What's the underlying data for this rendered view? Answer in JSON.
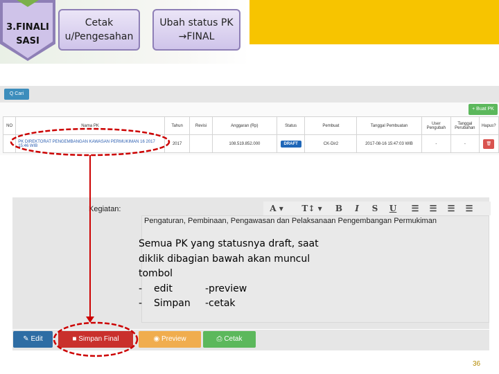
{
  "banner": {
    "step_label_line1": "3.FINALI",
    "step_label_line2": "SASI",
    "box1_line1": "Cetak",
    "box1_line2": "u/Pengesahan",
    "box2_line1": "Ubah status PK",
    "box2_line2": "→FINAL"
  },
  "search": {
    "cari_label": "Q Cari"
  },
  "create": {
    "buat_label": "+ Buat PK"
  },
  "table": {
    "headers": [
      "NO",
      "Nama PK",
      "Tahun",
      "Revisi",
      "Anggaran (Rp)",
      "Status",
      "Pembuat",
      "Tanggal Pembuatan",
      "User Pengubah",
      "Tanggal Perubahan",
      "Hapus?"
    ],
    "row": {
      "no": "",
      "nama": "PK DIREKTORAT PENGEMBANGAN KAWASAN PERMUKIMAN 16 2017 15:46 WIB",
      "tahun": "2017",
      "revisi": "",
      "anggaran": "108.519.852.000",
      "status": "DRAFT",
      "pembuat": "CK-Dir2",
      "tanggal_pembuatan": "2017-08-16 15:47:03 WIB",
      "user_pengubah": "-",
      "tanggal_perubahan": "-",
      "hapus_icon": "trash-icon"
    }
  },
  "editor": {
    "kegiatan_label": "Kegiatan:",
    "content_line": "Pengaturan, Pembinaan, Pengawasan dan Pelaksanaan Pengembangan Permukiman",
    "toolbar_icons": [
      "font-color-icon",
      "text-size-icon",
      "bold-icon",
      "italic-icon",
      "strikethrough-icon",
      "underline-icon",
      "bullet-list-icon",
      "numbered-list-icon",
      "align-left-icon",
      "align-center-icon"
    ]
  },
  "note": {
    "line1": "Semua  PK yang statusnya draft, saat",
    "line2": "diklik dibagian bawah akan muncul",
    "line3": "tombol",
    "item1_dash": "-",
    "item1_a": "edit",
    "item1_b": "-preview",
    "item2_dash": "-",
    "item2_a": "Simpan",
    "item2_b": "-cetak"
  },
  "actions": {
    "edit_label": "Edit",
    "simpan_final_label": "Simpan Final",
    "preview_label": "Preview",
    "cetak_label": "Cetak"
  },
  "colors": {
    "accent_yellow": "#f7c400",
    "edit_blue": "#2e6da4",
    "simpan_red": "#c9302c",
    "preview_orange": "#f0ad4e",
    "cetak_green": "#5cb85c",
    "annotation_red": "#cc0000"
  },
  "page_number": "36"
}
